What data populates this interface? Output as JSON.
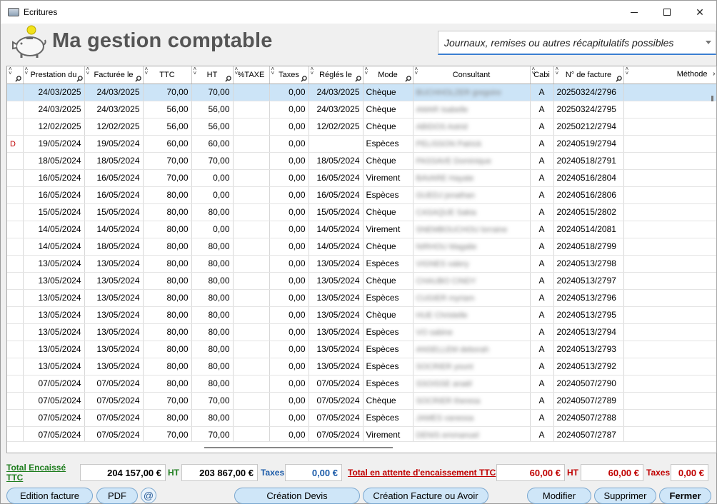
{
  "window": {
    "title": "Ecritures",
    "min_label": "",
    "close_glyph": "✕"
  },
  "header": {
    "app_title": "Ma gestion comptable",
    "combo_value": "Journaux, remises ou autres récapitulatifs possibles"
  },
  "columns": [
    "",
    "Prestation du",
    "Facturée le",
    "TTC",
    "HT",
    "%TAXE",
    "Taxes",
    "Réglés le",
    "Mode",
    "Consultant",
    "Cabi",
    "N° de facture",
    "Méthode"
  ],
  "rows": [
    {
      "flag": "",
      "prestation": "24/03/2025",
      "facturee": "24/03/2025",
      "ttc": "70,00",
      "ht": "70,00",
      "taxe_pct": "",
      "taxes": "0,00",
      "regles": "24/03/2025",
      "mode": "Chèque",
      "consultant": "BUCHHOLZER gregoire",
      "cabi": "A",
      "facture": "20250324/2796",
      "methode": ""
    },
    {
      "flag": "",
      "prestation": "24/03/2025",
      "facturee": "24/03/2025",
      "ttc": "56,00",
      "ht": "56,00",
      "taxe_pct": "",
      "taxes": "0,00",
      "regles": "24/03/2025",
      "mode": "Chèque",
      "consultant": "AMAR Isabelle",
      "cabi": "A",
      "facture": "20250324/2795",
      "methode": ""
    },
    {
      "flag": "",
      "prestation": "12/02/2025",
      "facturee": "12/02/2025",
      "ttc": "56,00",
      "ht": "56,00",
      "taxe_pct": "",
      "taxes": "0,00",
      "regles": "12/02/2025",
      "mode": "Chèque",
      "consultant": "ABIDOS Astrid",
      "cabi": "A",
      "facture": "20250212/2794",
      "methode": ""
    },
    {
      "flag": "D",
      "prestation": "19/05/2024",
      "facturee": "19/05/2024",
      "ttc": "60,00",
      "ht": "60,00",
      "taxe_pct": "",
      "taxes": "0,00",
      "regles": "",
      "mode": "Espèces",
      "consultant": "PELISSON Patrick",
      "cabi": "A",
      "facture": "20240519/2794",
      "methode": ""
    },
    {
      "flag": "",
      "prestation": "18/05/2024",
      "facturee": "18/05/2024",
      "ttc": "70,00",
      "ht": "70,00",
      "taxe_pct": "",
      "taxes": "0,00",
      "regles": "18/05/2024",
      "mode": "Chèque",
      "consultant": "PASSAVE Dominique",
      "cabi": "A",
      "facture": "20240518/2791",
      "methode": ""
    },
    {
      "flag": "",
      "prestation": "16/05/2024",
      "facturee": "16/05/2024",
      "ttc": "70,00",
      "ht": "0,00",
      "taxe_pct": "",
      "taxes": "0,00",
      "regles": "16/05/2024",
      "mode": "Virement",
      "consultant": "BAVARE Hayate",
      "cabi": "A",
      "facture": "20240516/2804",
      "methode": ""
    },
    {
      "flag": "",
      "prestation": "16/05/2024",
      "facturee": "16/05/2024",
      "ttc": "80,00",
      "ht": "0,00",
      "taxe_pct": "",
      "taxes": "0,00",
      "regles": "16/05/2024",
      "mode": "Espèces",
      "consultant": "GUEDJ jonathan",
      "cabi": "A",
      "facture": "20240516/2806",
      "methode": ""
    },
    {
      "flag": "",
      "prestation": "15/05/2024",
      "facturee": "15/05/2024",
      "ttc": "80,00",
      "ht": "80,00",
      "taxe_pct": "",
      "taxes": "0,00",
      "regles": "15/05/2024",
      "mode": "Chèque",
      "consultant": "CASAQUE Sakia",
      "cabi": "A",
      "facture": "20240515/2802",
      "methode": ""
    },
    {
      "flag": "",
      "prestation": "14/05/2024",
      "facturee": "14/05/2024",
      "ttc": "80,00",
      "ht": "0,00",
      "taxe_pct": "",
      "taxes": "0,00",
      "regles": "14/05/2024",
      "mode": "Virement",
      "consultant": "SNEMBOUCHOU lorraine",
      "cabi": "A",
      "facture": "20240514/2081",
      "methode": ""
    },
    {
      "flag": "",
      "prestation": "14/05/2024",
      "facturee": "18/05/2024",
      "ttc": "80,00",
      "ht": "80,00",
      "taxe_pct": "",
      "taxes": "0,00",
      "regles": "14/05/2024",
      "mode": "Chèque",
      "consultant": "NIRHOU Magalie",
      "cabi": "A",
      "facture": "20240518/2799",
      "methode": ""
    },
    {
      "flag": "",
      "prestation": "13/05/2024",
      "facturee": "13/05/2024",
      "ttc": "80,00",
      "ht": "80,00",
      "taxe_pct": "",
      "taxes": "0,00",
      "regles": "13/05/2024",
      "mode": "Espèces",
      "consultant": "VIGNES valery",
      "cabi": "A",
      "facture": "20240513/2798",
      "methode": ""
    },
    {
      "flag": "",
      "prestation": "13/05/2024",
      "facturee": "13/05/2024",
      "ttc": "80,00",
      "ht": "80,00",
      "taxe_pct": "",
      "taxes": "0,00",
      "regles": "13/05/2024",
      "mode": "Chèque",
      "consultant": "CHAUBO CINDY",
      "cabi": "A",
      "facture": "20240513/2797",
      "methode": ""
    },
    {
      "flag": "",
      "prestation": "13/05/2024",
      "facturee": "13/05/2024",
      "ttc": "80,00",
      "ht": "80,00",
      "taxe_pct": "",
      "taxes": "0,00",
      "regles": "13/05/2024",
      "mode": "Espèces",
      "consultant": "CUGIER myriam",
      "cabi": "A",
      "facture": "20240513/2796",
      "methode": ""
    },
    {
      "flag": "",
      "prestation": "13/05/2024",
      "facturee": "13/05/2024",
      "ttc": "80,00",
      "ht": "80,00",
      "taxe_pct": "",
      "taxes": "0,00",
      "regles": "13/05/2024",
      "mode": "Chèque",
      "consultant": "HUE Christelle",
      "cabi": "A",
      "facture": "20240513/2795",
      "methode": ""
    },
    {
      "flag": "",
      "prestation": "13/05/2024",
      "facturee": "13/05/2024",
      "ttc": "80,00",
      "ht": "80,00",
      "taxe_pct": "",
      "taxes": "0,00",
      "regles": "13/05/2024",
      "mode": "Espèces",
      "consultant": "VO sabine",
      "cabi": "A",
      "facture": "20240513/2794",
      "methode": ""
    },
    {
      "flag": "",
      "prestation": "13/05/2024",
      "facturee": "13/05/2024",
      "ttc": "80,00",
      "ht": "80,00",
      "taxe_pct": "",
      "taxes": "0,00",
      "regles": "13/05/2024",
      "mode": "Espèces",
      "consultant": "ANSELLEM deborah",
      "cabi": "A",
      "facture": "20240513/2793",
      "methode": ""
    },
    {
      "flag": "",
      "prestation": "13/05/2024",
      "facturee": "13/05/2024",
      "ttc": "80,00",
      "ht": "80,00",
      "taxe_pct": "",
      "taxes": "0,00",
      "regles": "13/05/2024",
      "mode": "Espèces",
      "consultant": "SOCRIER yount",
      "cabi": "A",
      "facture": "20240513/2792",
      "methode": ""
    },
    {
      "flag": "",
      "prestation": "07/05/2024",
      "facturee": "07/05/2024",
      "ttc": "80,00",
      "ht": "80,00",
      "taxe_pct": "",
      "taxes": "0,00",
      "regles": "07/05/2024",
      "mode": "Espèces",
      "consultant": "SSOISSE anaël",
      "cabi": "A",
      "facture": "20240507/2790",
      "methode": ""
    },
    {
      "flag": "",
      "prestation": "07/05/2024",
      "facturee": "07/05/2024",
      "ttc": "70,00",
      "ht": "70,00",
      "taxe_pct": "",
      "taxes": "0,00",
      "regles": "07/05/2024",
      "mode": "Chèque",
      "consultant": "SOCRIER theresa",
      "cabi": "A",
      "facture": "20240507/2789",
      "methode": ""
    },
    {
      "flag": "",
      "prestation": "07/05/2024",
      "facturee": "07/05/2024",
      "ttc": "80,00",
      "ht": "80,00",
      "taxe_pct": "",
      "taxes": "0,00",
      "regles": "07/05/2024",
      "mode": "Espèces",
      "consultant": "JAMES vanessa",
      "cabi": "A",
      "facture": "20240507/2788",
      "methode": ""
    },
    {
      "flag": "",
      "prestation": "07/05/2024",
      "facturee": "07/05/2024",
      "ttc": "70,00",
      "ht": "70,00",
      "taxe_pct": "",
      "taxes": "0,00",
      "regles": "07/05/2024",
      "mode": "Virement",
      "consultant": "DENIS emmanuel",
      "cabi": "A",
      "facture": "20240507/2787",
      "methode": ""
    }
  ],
  "totals": {
    "encaisse_label": "Total Encaissé TTC",
    "encaisse_value": "204 157,00 €",
    "ht_label": "HT",
    "ht_value": "203 867,00 €",
    "taxes_label": "Taxes",
    "taxes_value": "0,00 €",
    "attente_label": "Total en attente d'encaissement TTC",
    "attente_value": "60,00 €",
    "attente_ht_label": "HT",
    "attente_ht_value": "60,00 €",
    "attente_taxes_label": "Taxes",
    "attente_taxes_value": "0,00 €"
  },
  "buttons": {
    "edition": "Edition facture",
    "pdf": "PDF",
    "at": "@",
    "devis": "Création Devis",
    "facture_avoir": "Création Facture ou Avoir",
    "modifier": "Modifier",
    "supprimer": "Supprimer",
    "fermer": "Fermer"
  },
  "colors": {
    "selected_row": "#cce4f7",
    "green_label": "#1e7d1e",
    "blue_label": "#1a5aa8",
    "red_label": "#c00000",
    "button_bg": "#cfe6f8"
  }
}
